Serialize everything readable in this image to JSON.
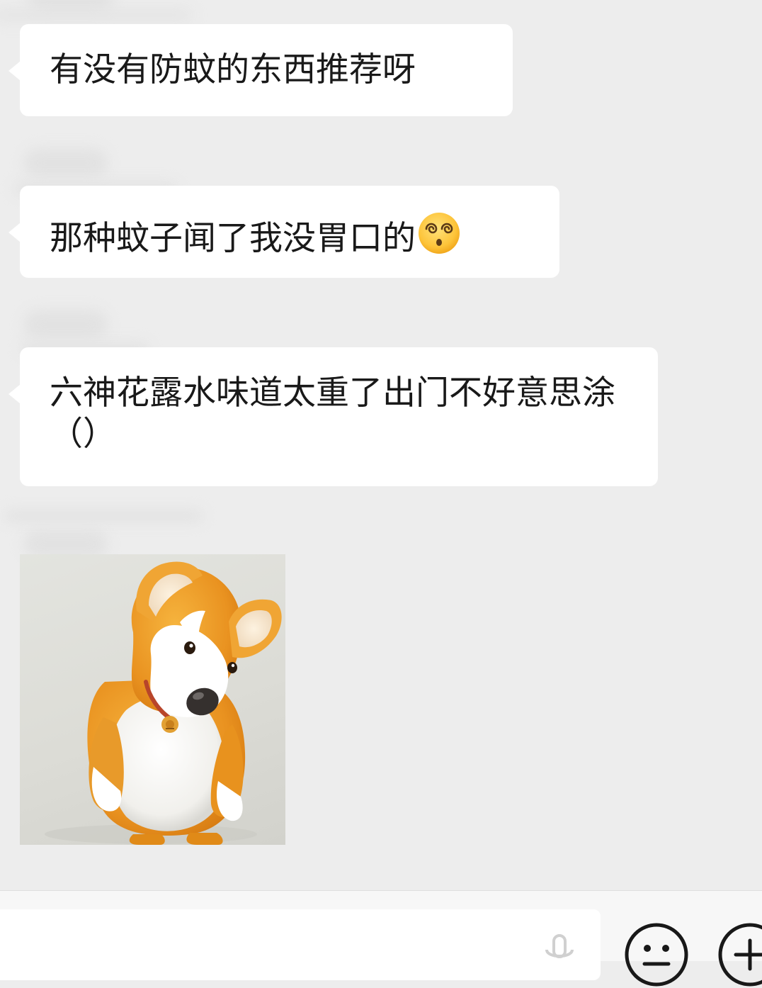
{
  "messages": [
    {
      "type": "text",
      "text": "有没有防蚊的东西推荐呀"
    },
    {
      "type": "text",
      "text": "那种蚊子闻了我没胃口的",
      "emoji": "dizzy-face-emoji"
    },
    {
      "type": "text",
      "text": "六神花露水味道太重了出门不好意思涂（）"
    },
    {
      "type": "sticker",
      "icon": "corgi-sticker"
    }
  ],
  "input_bar": {
    "placeholder": "",
    "icons": [
      "voice-icon",
      "emoji-icon",
      "plus-icon"
    ]
  },
  "colors": {
    "background": "#ededed",
    "bubble": "#ffffff",
    "text": "#191919",
    "input_bar": "#f7f7f7"
  }
}
